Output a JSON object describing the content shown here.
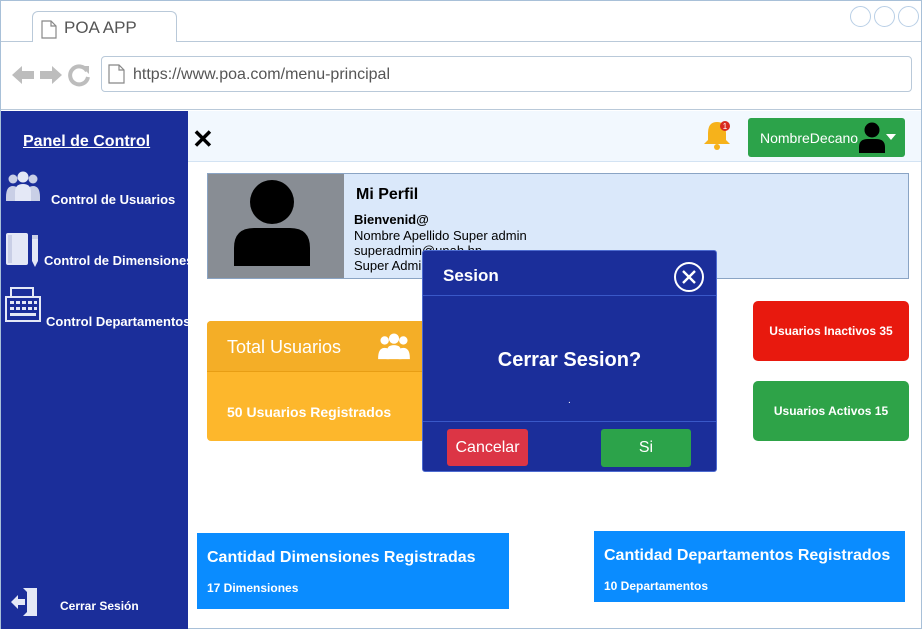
{
  "browser": {
    "tab_title": "POA APP",
    "url": "https://www.poa.com/menu-principal"
  },
  "sidebar": {
    "title": "Panel de Control",
    "items": [
      {
        "label": "Control de Usuarios",
        "icon": "users-icon"
      },
      {
        "label": "Control de Dimensiones",
        "icon": "notebook-icon"
      },
      {
        "label": "Control Departamentos",
        "icon": "keyboard-icon"
      }
    ],
    "logout_label": "Cerrar Sesión"
  },
  "topbar": {
    "close_symbol": "✕",
    "notification_count": "1",
    "user_name": "NombreDecano"
  },
  "profile": {
    "title": "Mi Perfil",
    "welcome": "Bienvenid@",
    "name_role": "Nombre Apellido Super admin",
    "email": "superadmin@unah.hn",
    "role": "Super Admin"
  },
  "cards": {
    "total_users_title": "Total Usuarios",
    "total_users_sub": "50 Usuarios Registrados",
    "inactive": "Usuarios Inactivos 35",
    "active": "Usuarios Activos 15",
    "dimensions_title": "Cantidad Dimensiones Registradas",
    "dimensions_sub": "17 Dimensiones",
    "departments_title": "Cantidad Departamentos Registrados",
    "departments_sub": "10 Departamentos"
  },
  "modal": {
    "title": "Sesion",
    "question": "Cerrar Sesion?",
    "dot": ".",
    "cancel_label": "Cancelar",
    "confirm_label": "Si"
  },
  "colors": {
    "sidebar": "#1b2e9a",
    "green": "#2ca34a",
    "red": "#e8190e",
    "orange": "#fdb72c",
    "blue": "#0a8cff"
  }
}
